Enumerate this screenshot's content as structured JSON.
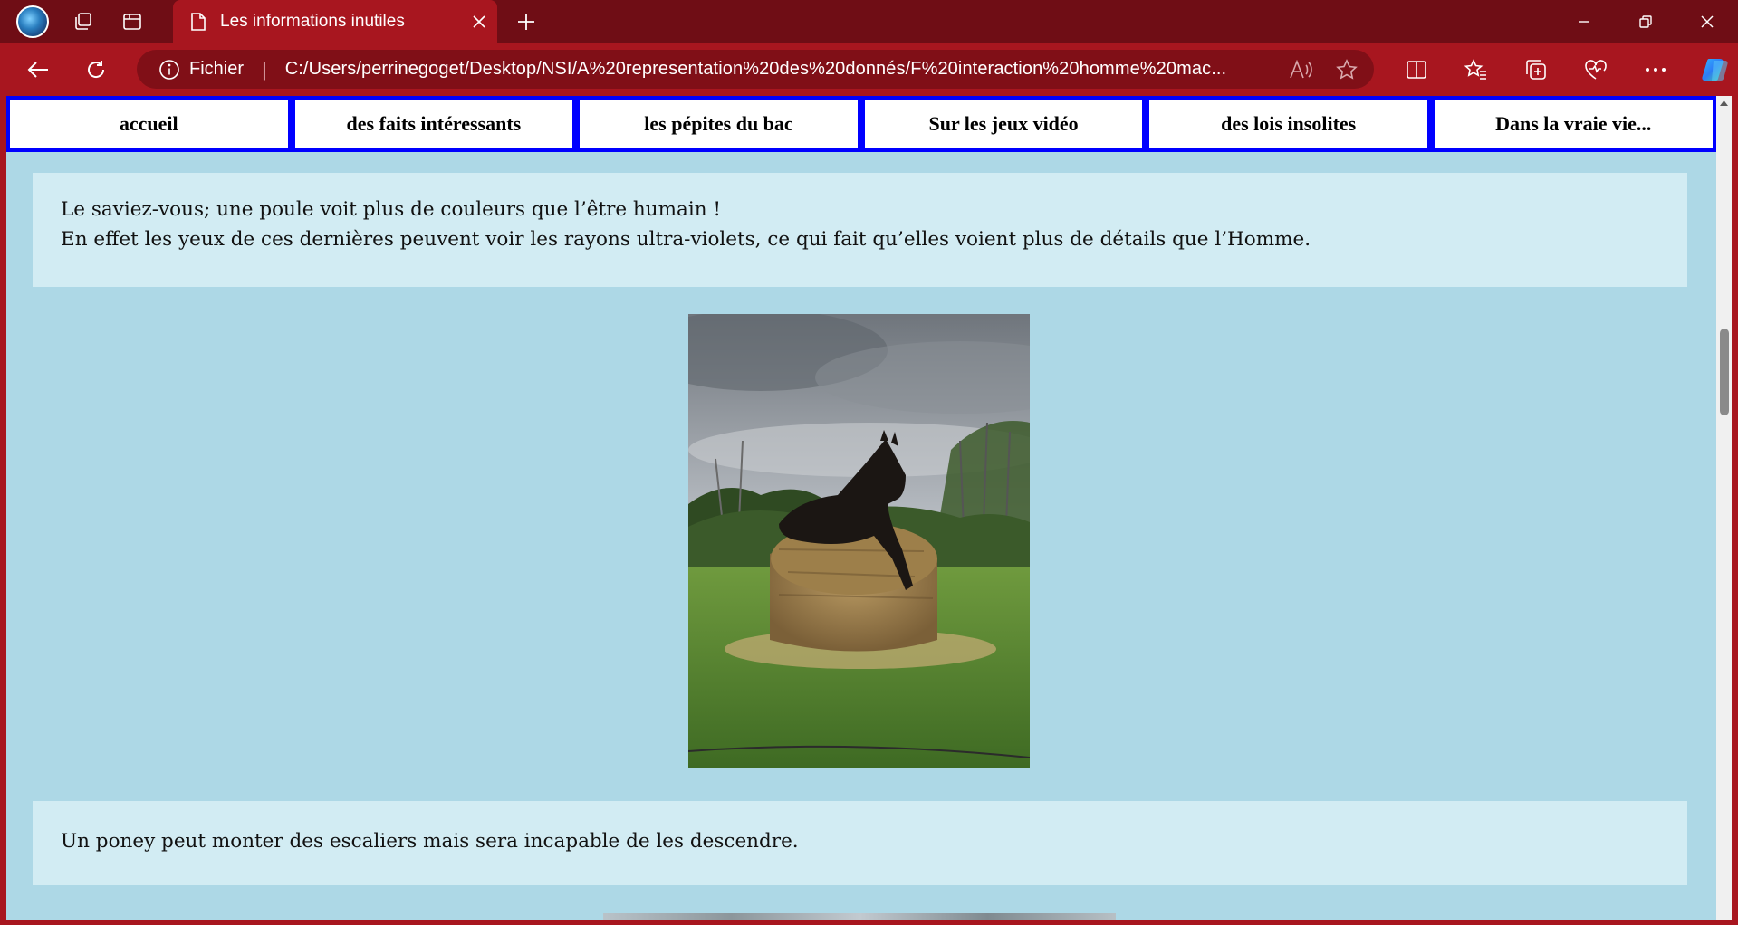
{
  "browser": {
    "tab_title": "Les informations inutiles",
    "address_scheme": "Fichier",
    "address_url": "C:/Users/perrinegoget/Desktop/NSI/A%20representation%20des%20donnés/F%20interaction%20homme%20mac...",
    "accent_color": "#a8161f"
  },
  "menu": {
    "items": [
      {
        "label": "accueil"
      },
      {
        "label": "des faits intéressants"
      },
      {
        "label": "les pépites du bac"
      },
      {
        "label": "Sur les jeux vidéo"
      },
      {
        "label": "des lois insolites"
      },
      {
        "label": "Dans la vraie vie..."
      }
    ]
  },
  "content": {
    "fact1_line1": "Le saviez-vous; une poule voit plus de couleurs que l’être humain !",
    "fact1_line2": "En effet les yeux de ces dernières peuvent voir les rayons ultra-violets, ce qui fait qu’elles voient plus de détails que l’Homme.",
    "fact2": "Un poney peut monter des escaliers mais sera incapable de les descendre."
  },
  "icons": {
    "profile": "profile-avatar-icon",
    "workspaces": "workspaces-icon",
    "tab_actions": "tab-actions-icon",
    "page": "page-icon",
    "close_tab": "close-icon",
    "new_tab": "plus-icon",
    "minimize": "minimize-icon",
    "restore": "restore-icon",
    "close_window": "close-icon",
    "back": "back-arrow-icon",
    "refresh": "refresh-icon",
    "info": "info-icon",
    "read_aloud": "read-aloud-icon",
    "favorite": "star-icon",
    "split": "split-screen-icon",
    "favorites": "favorites-icon",
    "collections": "collections-icon",
    "health": "browser-essentials-icon",
    "more": "more-icon",
    "copilot": "copilot-icon"
  }
}
